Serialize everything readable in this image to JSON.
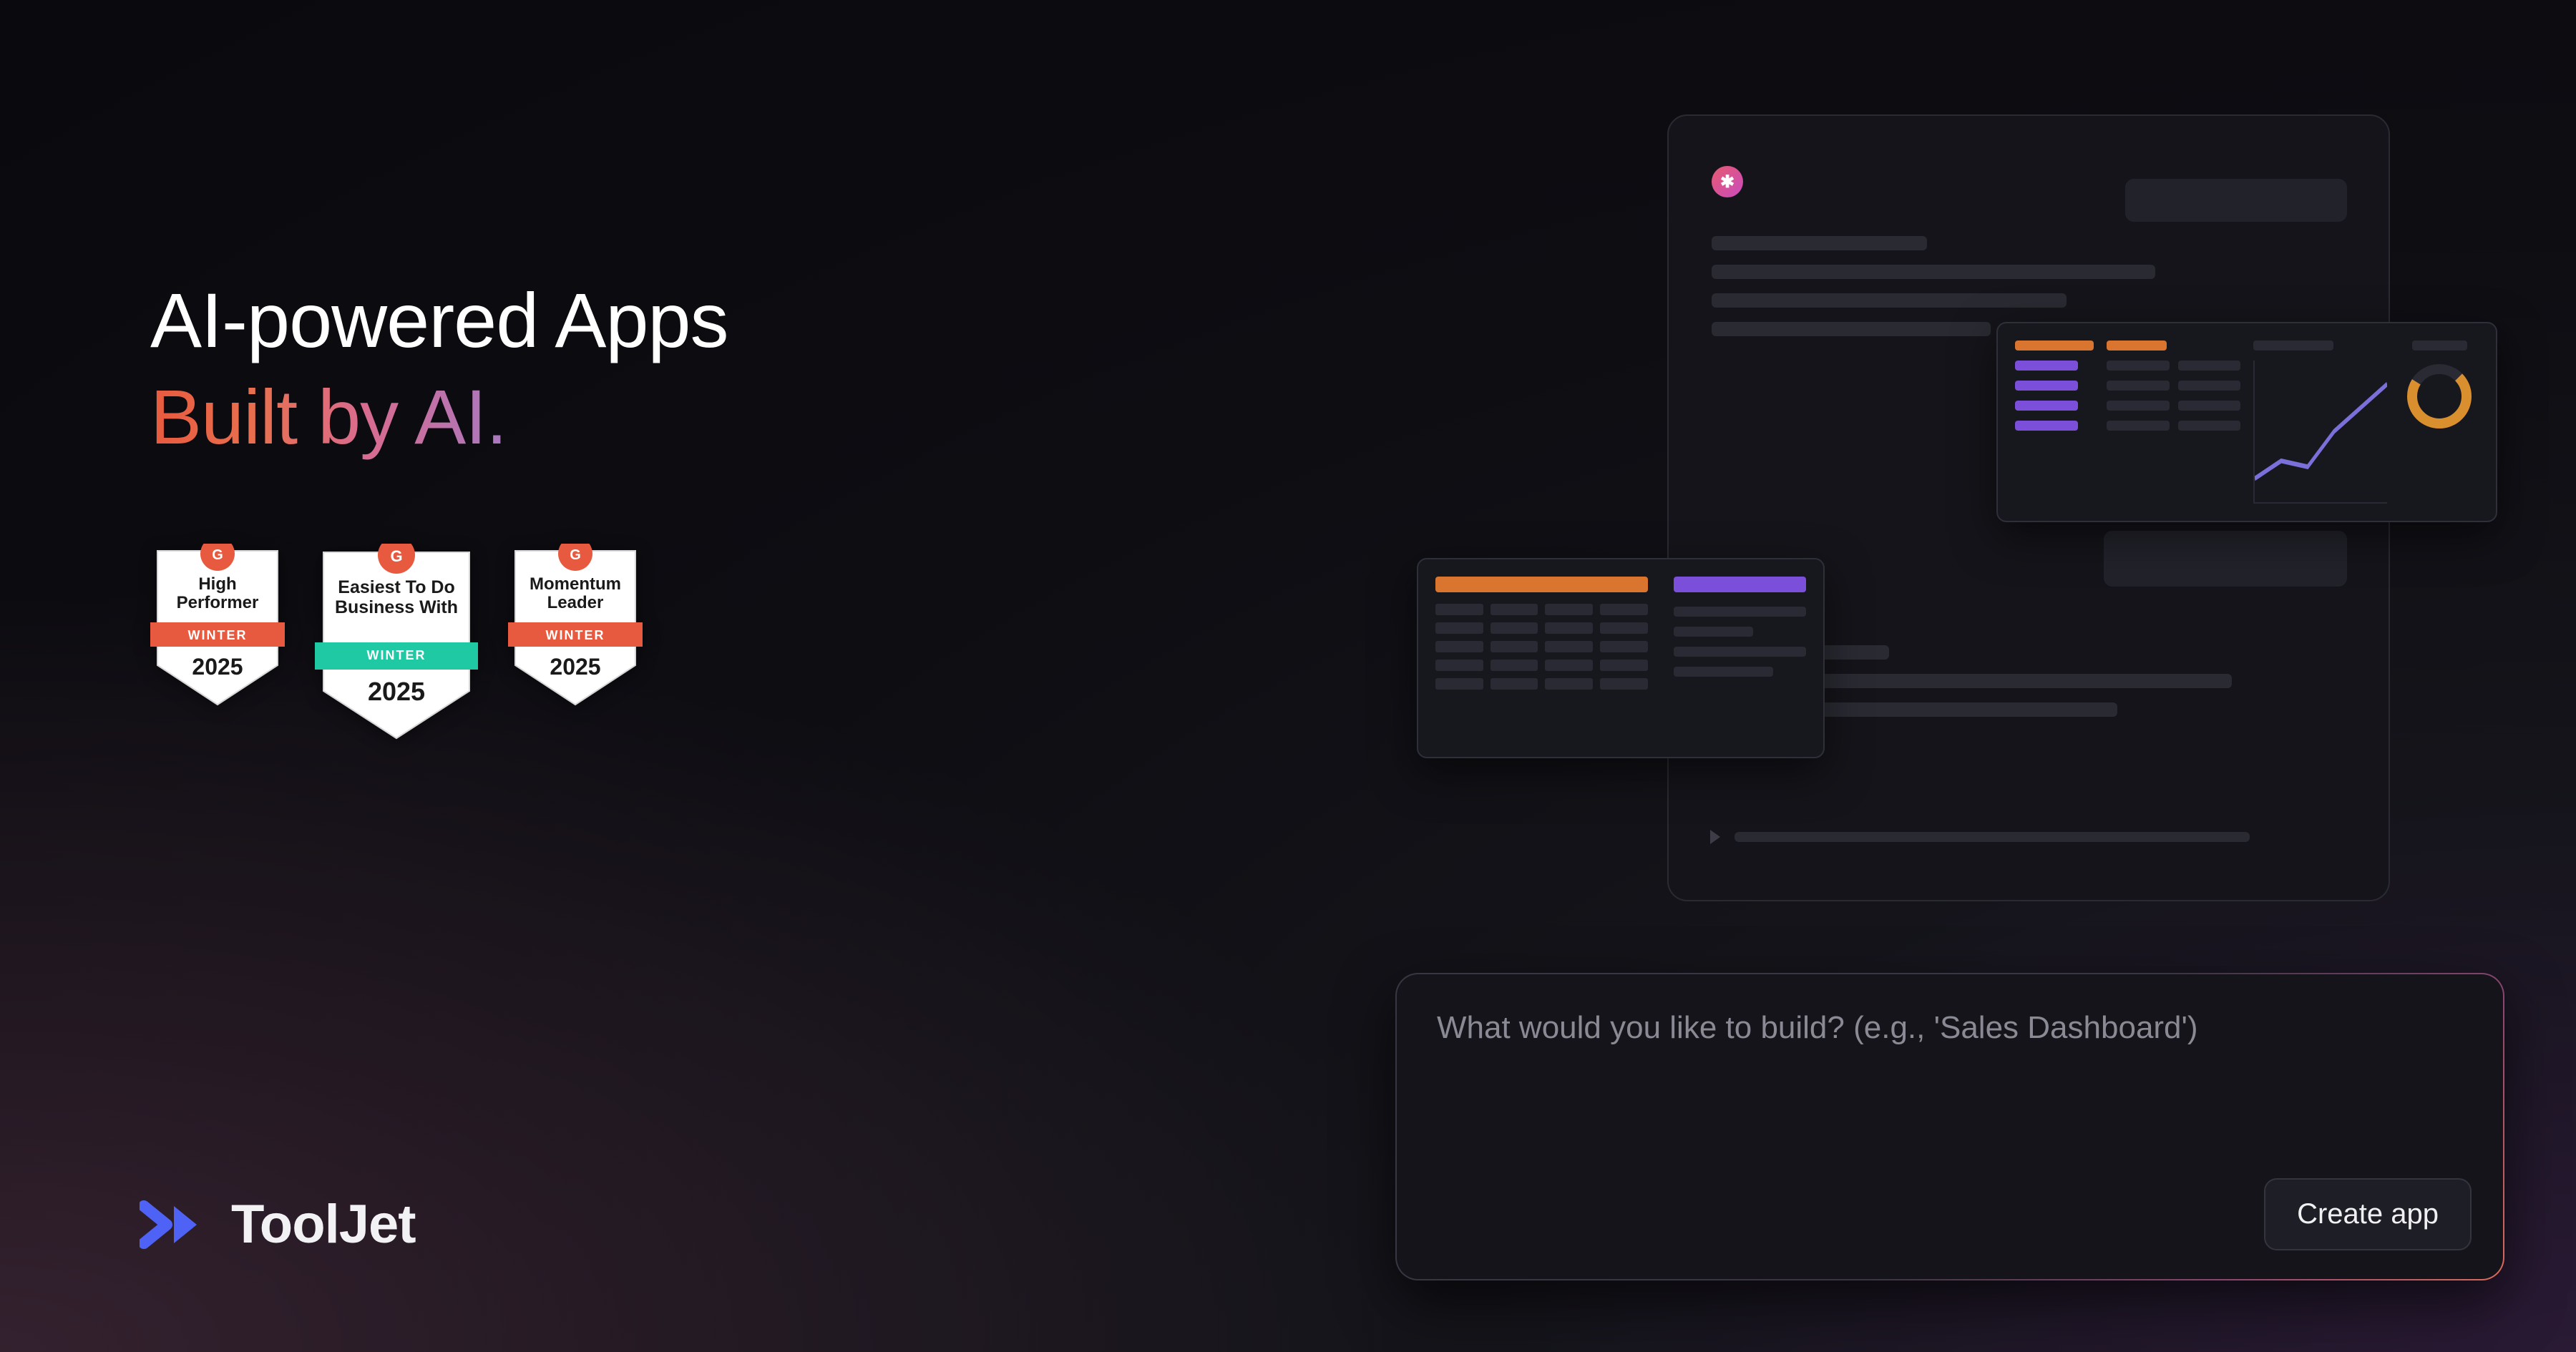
{
  "headline": {
    "line1": "AI-powered Apps",
    "line2": "Built by AI."
  },
  "badges": [
    {
      "title": "High Performer",
      "season": "WINTER",
      "year": "2025",
      "ribbon": "#e85a3f"
    },
    {
      "title": "Easiest To Do Business With",
      "season": "WINTER",
      "year": "2025",
      "ribbon": "#1ec9a3"
    },
    {
      "title": "Momentum Leader",
      "season": "WINTER",
      "year": "2025",
      "ribbon": "#e85a3f"
    }
  ],
  "brand": {
    "name": "ToolJet",
    "logo_color": "#4e63f5"
  },
  "prompt": {
    "placeholder": "What would you like to build? (e.g., 'Sales Dashboard')",
    "button_label": "Create app"
  },
  "mockups": {
    "close_icon": "✱",
    "accent_orange": "#d9752e",
    "accent_purple": "#7b4fd9",
    "donut_color": "#d98f2e"
  }
}
